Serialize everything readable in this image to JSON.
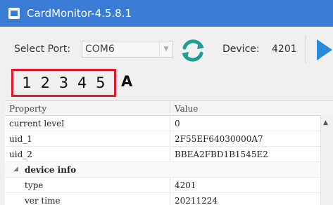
{
  "window": {
    "title": "CardMonitor-4.5.8.1"
  },
  "toolbar": {
    "port_label": "Select Port:",
    "port_value": "COM6",
    "device_label": "Device:",
    "device_value": "4201"
  },
  "levels": [
    "1",
    "2",
    "3",
    "4",
    "5"
  ],
  "level_extra": "A",
  "grid": {
    "headers": {
      "property": "Property",
      "value": "Value"
    },
    "rows": [
      {
        "property": "current level",
        "value": "0"
      },
      {
        "property": "uid_1",
        "value": "2F55EF64030000A7"
      },
      {
        "property": "uid_2",
        "value": "BBEA2FBD1B1545E2"
      }
    ],
    "group": {
      "label": "device info",
      "rows": [
        {
          "property": "type",
          "value": "4201"
        },
        {
          "property": "ver time",
          "value": "20211224"
        }
      ]
    }
  },
  "colors": {
    "titlebar": "#3a7bd5",
    "highlight_border": "#e3162a",
    "refresh": "#1f9e8e",
    "play": "#2b8ad9"
  },
  "icons": [
    "app-icon",
    "refresh-icon",
    "play-icon",
    "chevron-down-icon",
    "caret-expand-icon",
    "scroll-up-icon"
  ]
}
